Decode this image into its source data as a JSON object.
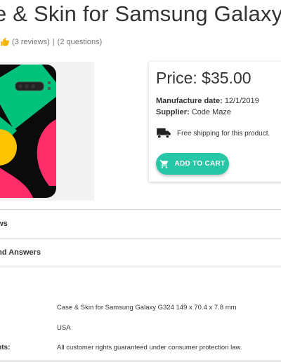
{
  "product": {
    "title": "e & Skin for Samsung Galaxy",
    "reviews_link": "(3 reviews)",
    "separator": "|",
    "questions_link": "(2 questions)"
  },
  "price_card": {
    "price": "Price: $35.00",
    "manufacture_label": "Manufacture date:",
    "manufacture_value": "12/1/2019",
    "supplier_label": "Supplier:",
    "supplier_value": "Code Maze",
    "shipping_text": "Free shipping for this product.",
    "cart_button": "ADD TO CART"
  },
  "sections": {
    "reviews": "ews",
    "questions": "and Answers"
  },
  "description": {
    "heading": "n",
    "specs": [
      {
        "label": "",
        "value": "Case & Skin for Samsung Galaxy G324 149 x 70.4 x 7.8 mm"
      },
      {
        "label": "",
        "value": "USA"
      },
      {
        "label": "ghts:",
        "value": "All customer rights guaranteed under consumer protection law."
      }
    ]
  },
  "colors": {
    "accent": "#26c6a6",
    "rating": "#f5b301",
    "case_green": "#00c27a",
    "case_pink": "#ff2d6a",
    "case_yellow": "#ffc400"
  }
}
